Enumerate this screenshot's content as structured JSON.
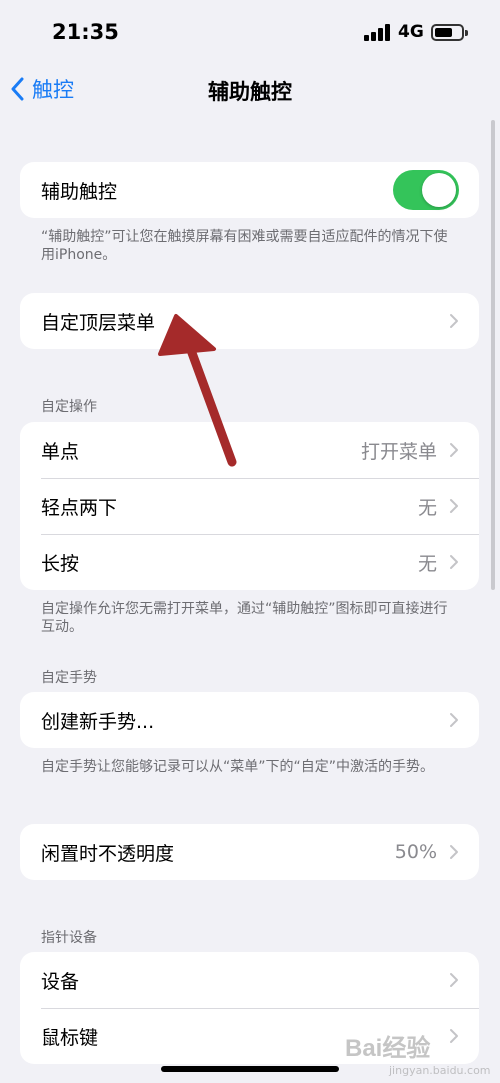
{
  "status_bar": {
    "time": "21:35",
    "network": "4G"
  },
  "nav": {
    "back_label": "触控",
    "title": "辅助触控"
  },
  "assistive_touch": {
    "label": "辅助触控",
    "toggle_on": true,
    "footnote": "“辅助触控”可让您在触摸屏幕有困难或需要自适应配件的情况下使用iPhone。"
  },
  "top_menu": {
    "label": "自定顶层菜单"
  },
  "custom_actions": {
    "header": "自定操作",
    "rows": [
      {
        "label": "单点",
        "value": "打开菜单"
      },
      {
        "label": "轻点两下",
        "value": "无"
      },
      {
        "label": "长按",
        "value": "无"
      }
    ],
    "footnote": "自定操作允许您无需打开菜单，通过“辅助触控”图标即可直接进行互动。"
  },
  "custom_gestures": {
    "header": "自定手势",
    "create_label": "创建新手势...",
    "footnote": "自定手势让您能够记录可以从“菜单”下的“自定”中激活的手势。"
  },
  "idle_opacity": {
    "label": "闲置时不透明度",
    "value": "50%"
  },
  "pointer_devices": {
    "header": "指针设备",
    "rows": [
      {
        "label": "设备"
      },
      {
        "label": "鼠标键"
      }
    ]
  },
  "colors": {
    "accent": "#1a7cf5",
    "toggle_on": "#34c45a",
    "annotation_arrow": "#a52a2a"
  },
  "watermark": {
    "brand": "Bai经验",
    "domain": "jingyan.baidu.com"
  }
}
